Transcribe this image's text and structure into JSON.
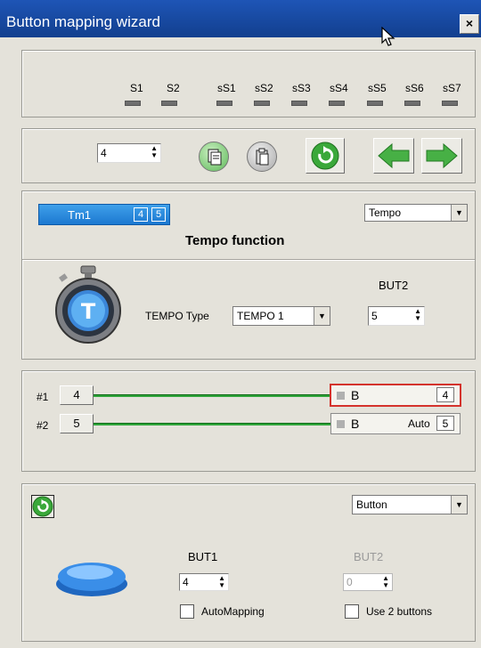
{
  "window": {
    "title": "Button mapping wizard",
    "close_label": "×"
  },
  "status_panel": {
    "labels": [
      "S1",
      "S2",
      "sS1",
      "sS2",
      "sS3",
      "sS4",
      "sS5",
      "sS6",
      "sS7"
    ]
  },
  "toolbar": {
    "value": "4"
  },
  "function_panel": {
    "tab_label": "Tm1",
    "tab_badge_1": "4",
    "tab_badge_2": "5",
    "mode_select": "Tempo",
    "heading": "Tempo function",
    "tempo_type_label": "TEMPO Type",
    "tempo_type_value": "TEMPO 1",
    "but2_label": "BUT2",
    "but2_value": "5"
  },
  "mapping_panel": {
    "rows": [
      {
        "label": "#1",
        "button": "4",
        "target": "B",
        "auto": "",
        "value": "4"
      },
      {
        "label": "#2",
        "button": "5",
        "target": "B",
        "auto": "Auto",
        "value": "5"
      }
    ]
  },
  "button_panel": {
    "type_select": "Button",
    "but1_label": "BUT1",
    "but1_value": "4",
    "but2_label": "BUT2",
    "but2_value": "0",
    "automapping_label": "AutoMapping",
    "use2_label": "Use 2 buttons"
  },
  "colors": {
    "title_bar": "#1a4fae",
    "green_accent": "#3aa03d",
    "selection": "#d4322c"
  }
}
